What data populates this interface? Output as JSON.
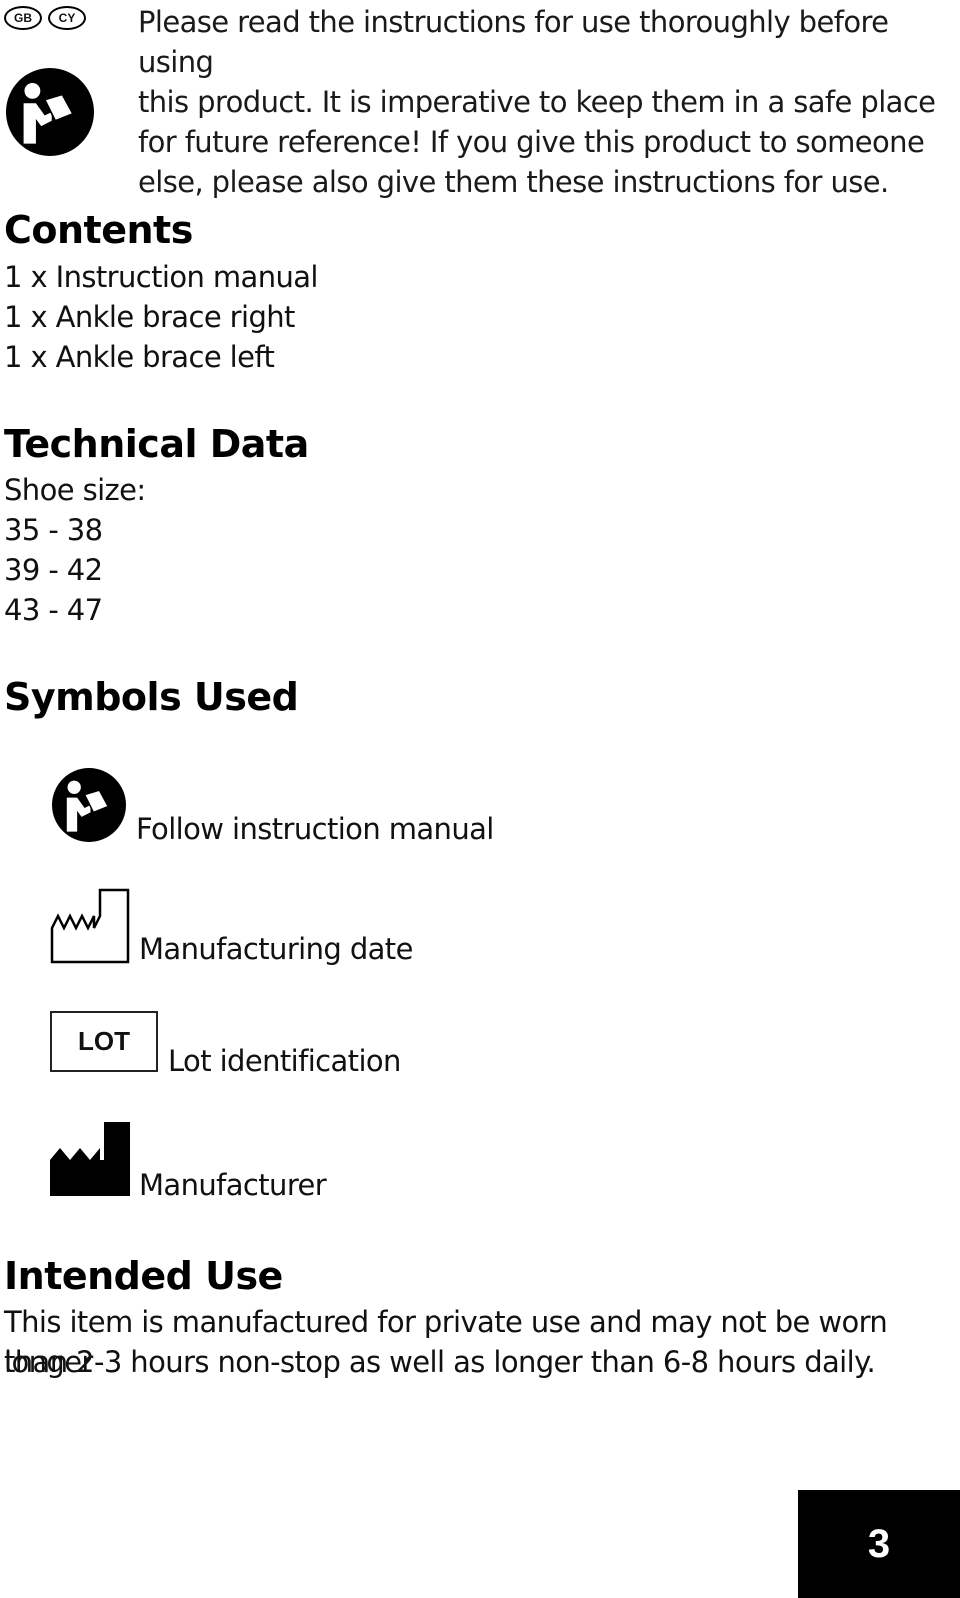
{
  "header": {
    "country_codes": [
      "GB",
      "CY"
    ],
    "intro_lines": [
      "Please read the instructions for use thoroughly before using",
      "this product. It is imperative to keep them in a safe place",
      "for future reference! If you give this product to someone",
      "else, please also give them these instructions for use."
    ]
  },
  "contents": {
    "title": "Contents",
    "items": [
      "1 x Instruction manual",
      "1 x Ankle brace right",
      "1 x Ankle brace left"
    ]
  },
  "technical_data": {
    "title": "Technical Data",
    "label": "Shoe size:",
    "sizes": [
      "35 - 38",
      "39 - 42",
      "43 - 47"
    ]
  },
  "symbols": {
    "title": "Symbols Used",
    "items": [
      {
        "icon": "read-manual-icon",
        "label": "Follow instruction manual"
      },
      {
        "icon": "manufacturing-date-icon",
        "label": "Manufacturing date"
      },
      {
        "icon": "lot-icon",
        "label": "Lot identification",
        "icon_text": "LOT"
      },
      {
        "icon": "manufacturer-icon",
        "label": "Manufacturer"
      }
    ]
  },
  "intended_use": {
    "title": "Intended Use",
    "lines": [
      "This item is manufactured for private use and may not be worn longer",
      "than 2-3 hours non-stop as well as longer than 6-8 hours daily."
    ]
  },
  "footer": {
    "page_number": "3"
  }
}
